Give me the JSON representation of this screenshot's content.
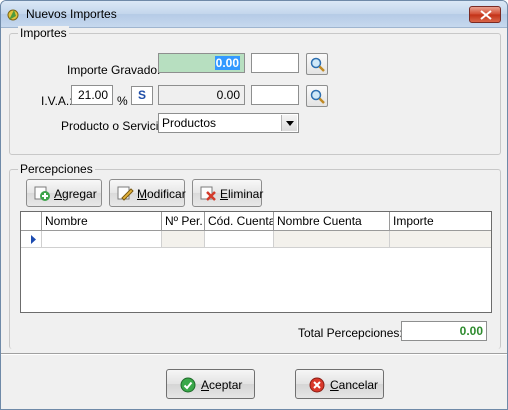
{
  "window": {
    "title": "Nuevos Importes"
  },
  "importes": {
    "legend": "Importes",
    "importe_gravado_label": "Importe Gravado:",
    "importe_gravado_value": "0.00",
    "iva_label": "I.V.A.:",
    "iva_rate": "21.00",
    "percent_sign": "%",
    "iva_flag": "S",
    "iva_amount": "0.00",
    "producto_label": "Producto o Servicio",
    "producto_value": "Productos"
  },
  "percepciones": {
    "legend": "Percepciones",
    "buttons": {
      "agregar_pre": "",
      "agregar_key": "A",
      "agregar_post": "gregar",
      "modificar_pre": "",
      "modificar_key": "M",
      "modificar_post": "odificar",
      "eliminar_pre": "",
      "eliminar_key": "E",
      "eliminar_post": "liminar"
    },
    "columns": [
      "Nombre",
      "Nº Per.",
      "Cód. Cuenta",
      "Nombre Cuenta",
      "Importe"
    ],
    "total_label": "Total Percepciones:",
    "total_value": "0.00"
  },
  "footer": {
    "aceptar_pre": "",
    "aceptar_key": "A",
    "aceptar_post": "ceptar",
    "cancelar_pre": "",
    "cancelar_key": "C",
    "cancelar_post": "ancelar"
  },
  "colors": {
    "accent_green": "#2e8b2e",
    "highlight": "#3399ff",
    "gravado_bg": "#b7dfc0"
  },
  "icons": [
    "app-icon",
    "close-icon",
    "search-icon",
    "combo-arrow-icon",
    "add-icon",
    "edit-icon",
    "delete-icon",
    "row-pointer-icon",
    "accept-icon",
    "cancel-icon"
  ]
}
